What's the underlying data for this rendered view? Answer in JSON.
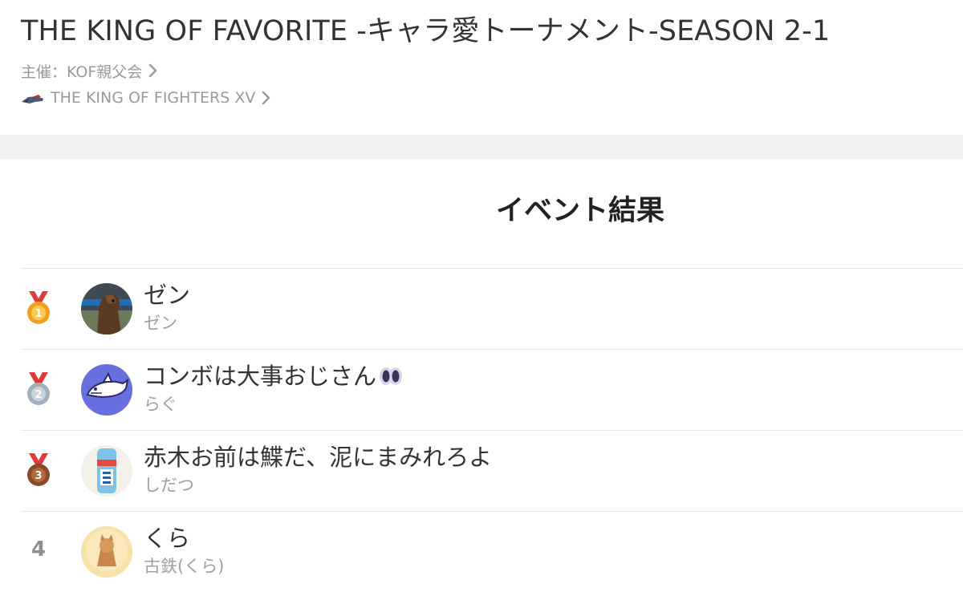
{
  "event": {
    "title": "THE KING OF FAVORITE -キャラ愛トーナメント-SEASON 2-1",
    "organizer_label": "主催：KOF親父会",
    "game_label": "THE KING OF FIGHTERS XV"
  },
  "results": {
    "heading": "イベント結果",
    "entries": [
      {
        "rank": "1",
        "medal": "gold",
        "team": "ゼン",
        "player": "ゼン",
        "avatar_icon": "horse-avatar-icon"
      },
      {
        "rank": "2",
        "medal": "silver",
        "team": "コンボは大事おじさん",
        "team_suffix_icon": "eyes-emoji-icon",
        "player": "らぐ",
        "avatar_icon": "shark-avatar-icon"
      },
      {
        "rank": "3",
        "medal": "bronze",
        "team": "赤木お前は鰈だ、泥にまみれろよ",
        "player": "しだつ",
        "avatar_icon": "drink-can-avatar-icon"
      },
      {
        "rank": "4",
        "team": "くら",
        "player": "古鉄(くら)",
        "avatar_icon": "character-avatar-icon"
      }
    ]
  },
  "colors": {
    "gold_medal": "#f0a020",
    "silver_medal": "#9fb0bb",
    "bronze_medal": "#8b4a25",
    "ribbon": "#e03a3a",
    "muted_text": "#a0a0a0",
    "band": "#f2f2f2"
  }
}
